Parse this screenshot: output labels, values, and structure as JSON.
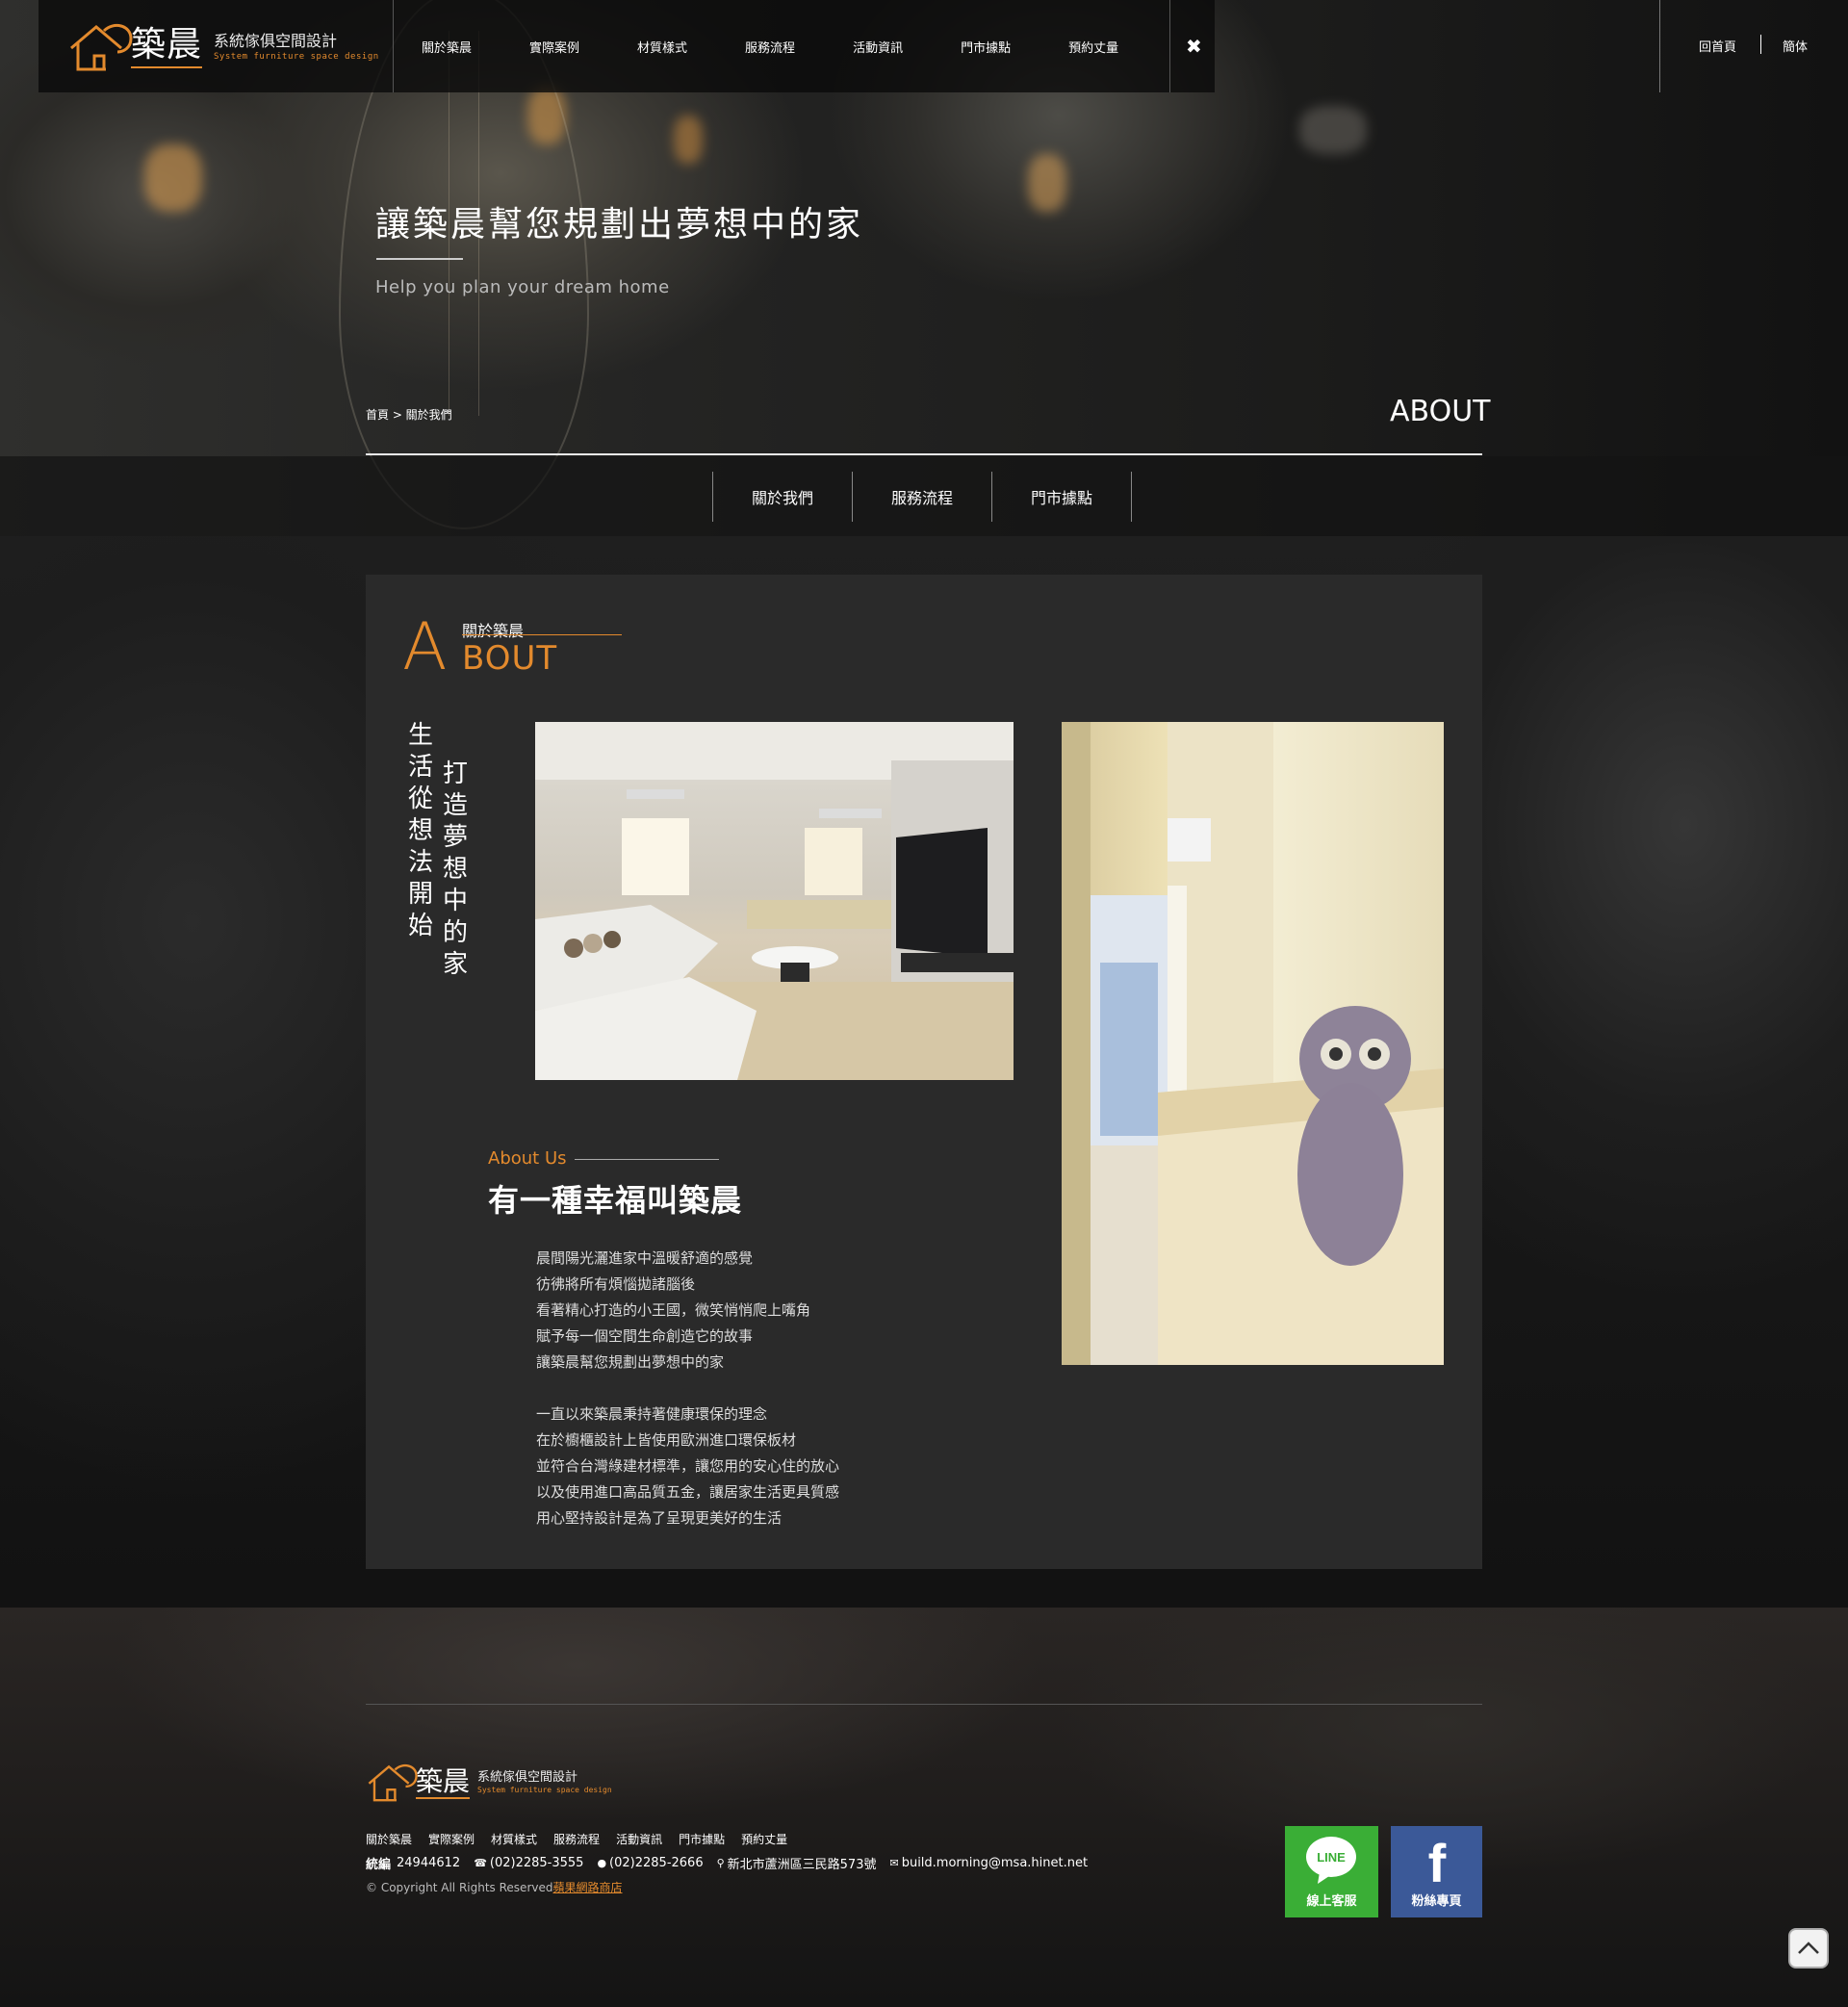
{
  "header": {
    "brand": "築晨",
    "brand_sub": "系統傢俱空間設計",
    "brand_sub_en": "System furniture space design",
    "nav": [
      "關於築晨",
      "實際案例",
      "材質樣式",
      "服務流程",
      "活動資訊",
      "門市據點",
      "預約丈量"
    ],
    "close_symbol": "✖",
    "home_link": "回首頁",
    "lang_link": "簡体"
  },
  "hero": {
    "title": "讓築晨幫您規劃出夢想中的家",
    "subtitle": "Help you plan your dream home",
    "breadcrumb": "首頁 > 關於我們",
    "section_label": "ABOUT",
    "subnav": [
      "關於我們",
      "服務流程",
      "門市據點"
    ]
  },
  "about": {
    "logo_letter": "A",
    "logo_title": "關於築晨",
    "logo_rest": "BOUT",
    "vertical_left": [
      "生",
      "活",
      "從",
      "想",
      "法",
      "開",
      "始"
    ],
    "vertical_right": [
      "打",
      "造",
      "夢",
      "想",
      "中",
      "的",
      "家"
    ],
    "about_us_label": "About Us",
    "headline": "有一種幸福叫築晨",
    "paragraph1": [
      "晨間陽光灑進家中溫暖舒適的感覺",
      "彷彿將所有煩惱拋諸腦後",
      "看著精心打造的小王國，微笑悄悄爬上嘴角",
      "賦予每一個空間生命創造它的故事",
      "讓築晨幫您規劃出夢想中的家"
    ],
    "paragraph2": [
      "一直以來築晨秉持著健康環保的理念",
      "在於櫥櫃設計上皆使用歐洲進口環保板材",
      "並符合台灣綠建材標準，讓您用的安心住的放心",
      "以及使用進口高品質五金，讓居家生活更具質感",
      "用心堅持設計是為了呈現更美好的生活"
    ]
  },
  "footer": {
    "brand": "築晨",
    "brand_sub": "系統傢俱空間設計",
    "brand_sub_en": "System furniture space design",
    "nav": [
      "關於築晨",
      "實際案例",
      "材質樣式",
      "服務流程",
      "活動資訊",
      "門市據點",
      "預約丈量"
    ],
    "tax_label": "統編",
    "tax_id": "24944612",
    "phone": "(02)2285-3555",
    "fax": "(02)2285-2666",
    "address": "新北市蘆洲區三民路573號",
    "email": "build.morning@msa.hinet.net",
    "copyright": "© Copyright All Rights Reserved",
    "copyright_link": "蘋果網路商店",
    "line_label": "線上客服",
    "line_logo": "LINE",
    "fb_label": "粉絲專頁",
    "fb_logo": "f"
  },
  "colors": {
    "accent": "#e38a2d",
    "line_green": "#3aae36",
    "facebook_blue": "#3b5998"
  }
}
